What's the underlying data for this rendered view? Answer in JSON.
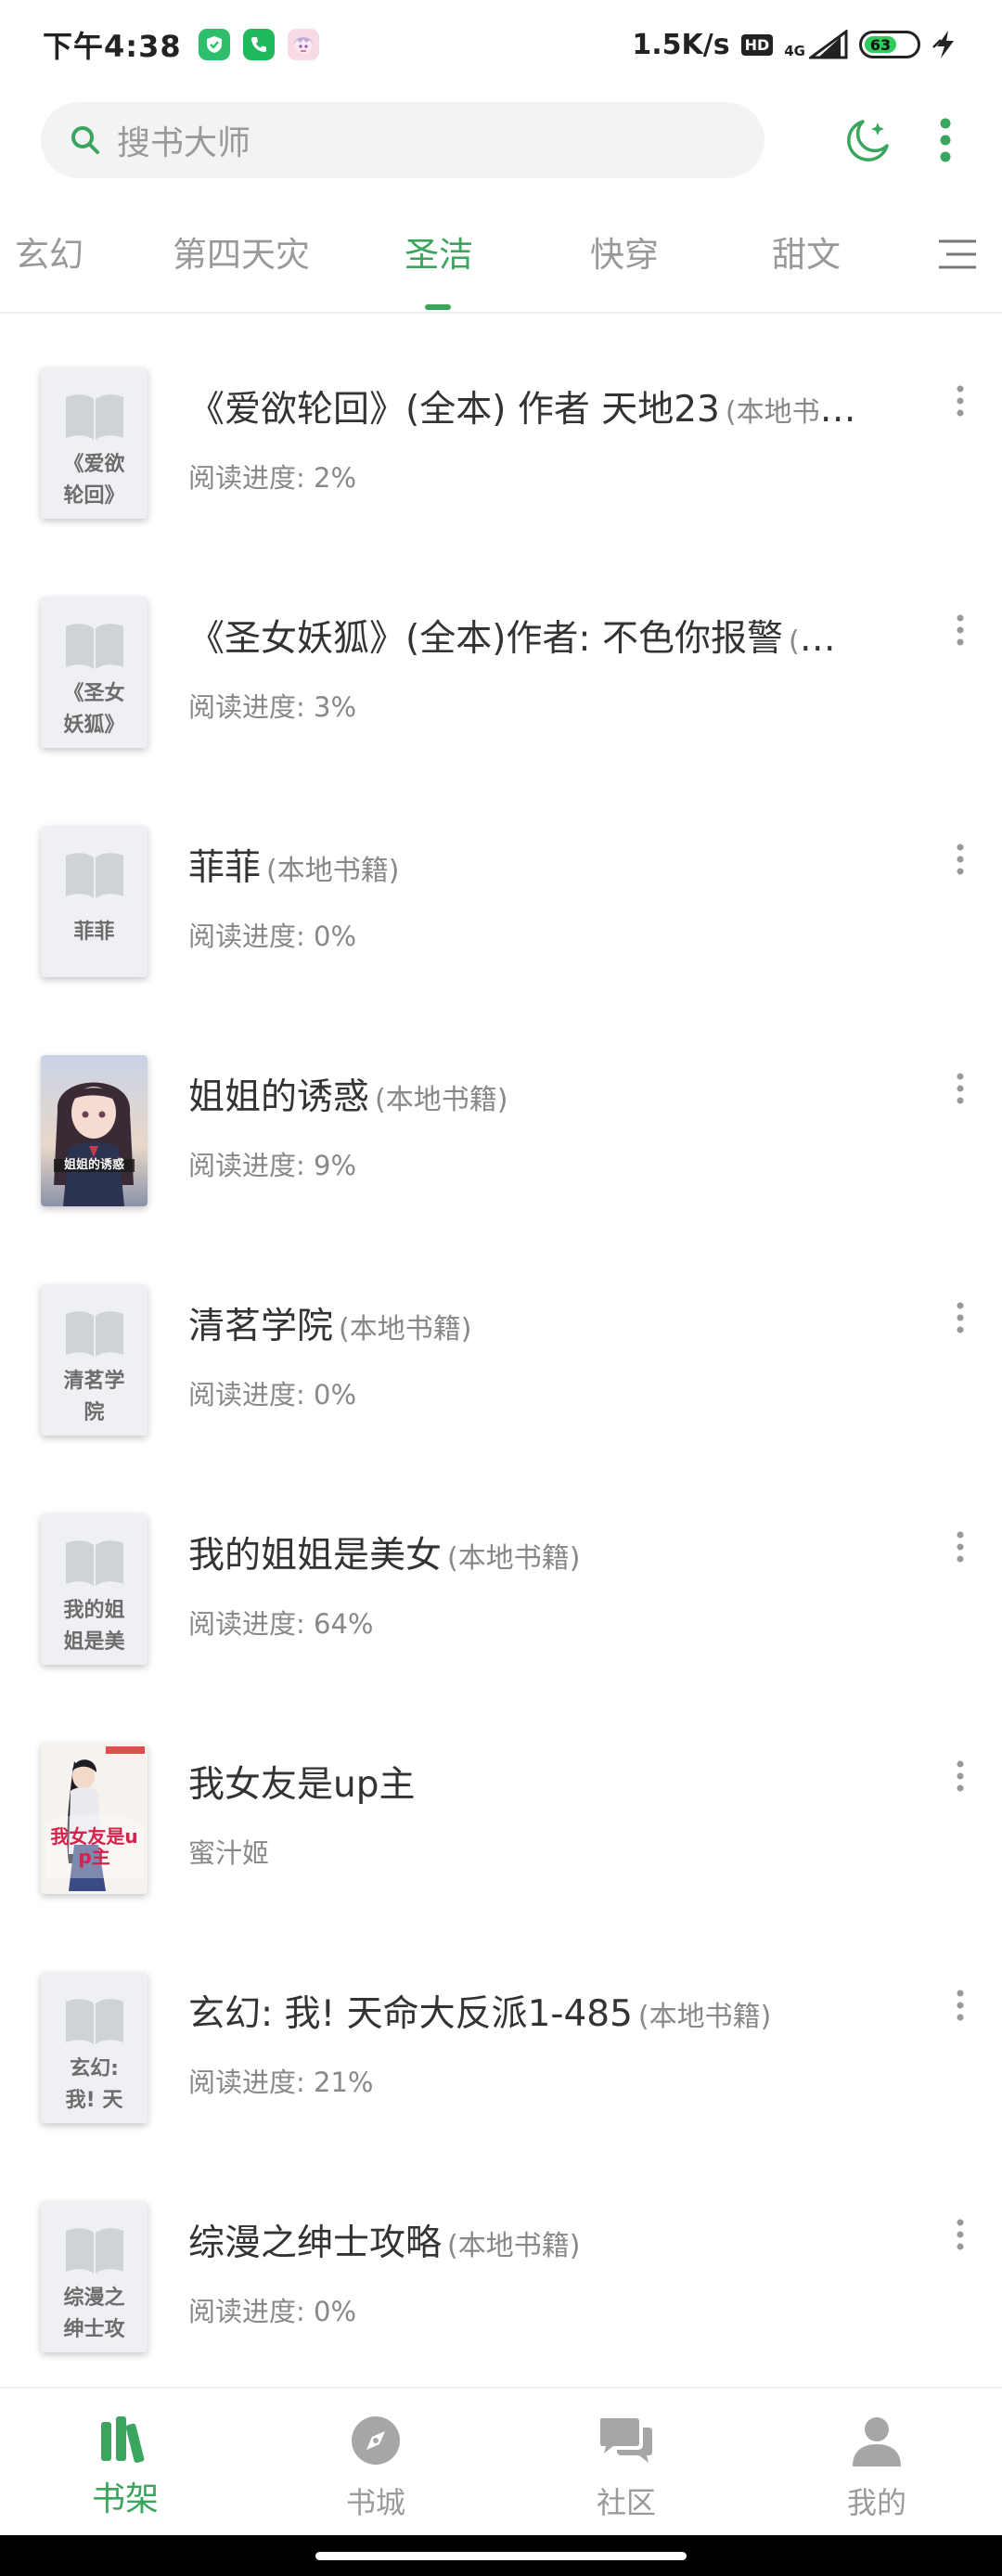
{
  "status_bar": {
    "time": "下午4:38",
    "net_speed": "1.5K/s",
    "hd": "HD",
    "network": "4G",
    "battery": "63"
  },
  "header": {
    "search_placeholder": "搜书大师"
  },
  "tabs": {
    "items": [
      "玄幻",
      "第四天灾",
      "圣洁",
      "快穿",
      "甜文"
    ],
    "active": "圣洁"
  },
  "books": [
    {
      "cover_text": "《爱欲轮回》",
      "title": "《爱欲轮回》(全本) 作者 天地23",
      "tag": "(本地书籍)",
      "sub": "阅读进度: 2%"
    },
    {
      "cover_text": "《圣女妖狐》",
      "title": "《圣女妖狐》(全本)作者: 不色你报警",
      "tag": "(本地书籍)",
      "sub": "阅读进度: 3%"
    },
    {
      "cover_text": "菲菲",
      "title": "菲菲",
      "tag": "(本地书籍)",
      "sub": "阅读进度: 0%"
    },
    {
      "cover_text": "姐姐的诱惑",
      "title": "姐姐的诱惑",
      "tag": "(本地书籍)",
      "sub": "阅读进度: 9%"
    },
    {
      "cover_text": "清茗学院",
      "title": "清茗学院",
      "tag": "(本地书籍)",
      "sub": "阅读进度: 0%"
    },
    {
      "cover_text": "我的姐姐是美",
      "title": "我的姐姐是美女",
      "tag": "(本地书籍)",
      "sub": "阅读进度: 64%"
    },
    {
      "cover_text": "我女友是up主",
      "title": "我女友是up主",
      "tag": "",
      "sub": "蜜汁姬"
    },
    {
      "cover_text": "玄幻: 我! 天",
      "title": "玄幻: 我! 天命大反派1-485",
      "tag": "(本地书籍)",
      "sub": "阅读进度: 21%"
    },
    {
      "cover_text": "综漫之绅士攻",
      "title": "综漫之绅士攻略",
      "tag": "(本地书籍)",
      "sub": "阅读进度: 0%"
    }
  ],
  "bottom_nav": {
    "items": [
      "书架",
      "书城",
      "社区",
      "我的"
    ],
    "active": "书架"
  },
  "colors": {
    "accent": "#3aa55c",
    "text_primary": "#333333",
    "text_secondary": "#888888"
  }
}
